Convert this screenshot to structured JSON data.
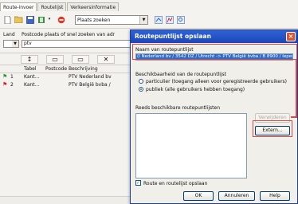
{
  "tabs": [
    {
      "label": "Route-invoer",
      "active": true
    },
    {
      "label": "Routelijst",
      "active": false
    },
    {
      "label": "Verkeersinformatie",
      "active": false
    }
  ],
  "toolbar": {
    "icons": [
      "new-icon",
      "open-icon",
      "save-icon",
      "book-icon",
      "stop-icon",
      "dropdown-icon"
    ],
    "place_combo": "Plaats zoeken",
    "extra_icons": [
      "route-icon",
      "map-icon",
      "zoom-icon"
    ]
  },
  "search": {
    "land_label": "Land",
    "postcode_label": "Postcode plaats of snel zoeken van adr",
    "postcode_value": "ptv"
  },
  "grid_toolbar": {
    "buttons": [
      "↕",
      "▭",
      "▭",
      "✕"
    ]
  },
  "grid": {
    "columns": [
      "Tabel",
      "Postcode",
      "Beschrijving"
    ],
    "rows": [
      {
        "nr": "1",
        "tabel": "Kant...",
        "postcode": "",
        "beschrijving": "PTV Nederland bv"
      },
      {
        "nr": "2",
        "tabel": "Kant...",
        "postcode": "",
        "beschrijving": "PTV België bvba /"
      }
    ]
  },
  "dialog": {
    "title": "Routepuntlijst opslaan",
    "name_label": "Naam van routepuntlijst",
    "name_value": "(I Nederland bv / 3542 DZ / Utrecht -> PTV België bvba / B 8900 / Ieper",
    "availability_label": "Beschikbaarheid van de routepuntlijst",
    "option_private": "particulier (toegang alleen voor geregistreerde gebruikers)",
    "option_public": "publiek (alle gebruikers hebben toegang)",
    "selected_option": "public",
    "existing_label": "Reeds beschikbare routepuntlijsten",
    "delete_button": "Verwijderen",
    "extern_button": "Extern...",
    "save_check_label": "Route en routelijst opslaan",
    "save_check_checked": true,
    "ok_button": "OK",
    "cancel_button": "Annuleren",
    "help_button": "Help",
    "close_symbol": "×"
  },
  "colors": {
    "titlebar": "#2f62d6",
    "selection": "#316ac5",
    "annotation": "#d64545"
  }
}
